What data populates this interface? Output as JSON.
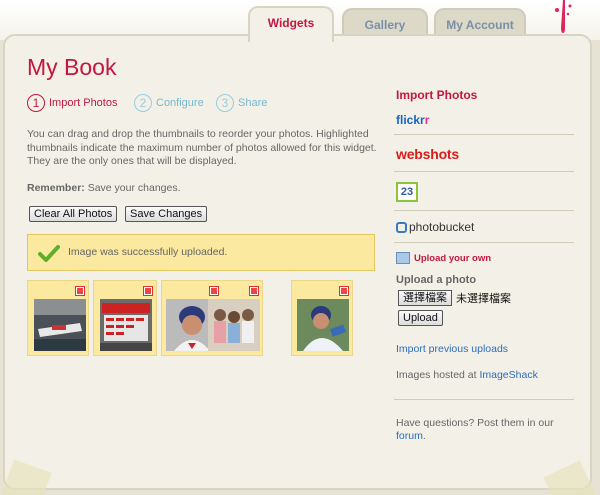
{
  "tabs": [
    {
      "label": "Widgets",
      "active": true
    },
    {
      "label": "Gallery",
      "active": false
    },
    {
      "label": "My Account",
      "active": false
    }
  ],
  "page": {
    "title": "My Book"
  },
  "steps": [
    {
      "num": "1",
      "label": "Import Photos",
      "active": true
    },
    {
      "num": "2",
      "label": "Configure",
      "active": false
    },
    {
      "num": "3",
      "label": "Share",
      "active": false
    }
  ],
  "description": "You can drag and drop the thumbnails to reorder your photos. Highlighted thumbnails indicate the maximum number of photos allowed for this widget. They are the only ones that will be displayed.",
  "remember": {
    "bold": "Remember:",
    "text": " Save your changes."
  },
  "buttons": {
    "clear_all": "Clear All Photos",
    "save_changes": "Save Changes"
  },
  "notice": {
    "message": "Image was successfully uploaded."
  },
  "sidebar": {
    "title": "Import Photos",
    "services": {
      "flickr_main": "flickr",
      "flickr_r": "r",
      "webshots": "webshots",
      "twentythree": "23",
      "photobucket": "photobucket"
    },
    "upload_own": "Upload your own",
    "upload_heading": "Upload a photo",
    "file_button": "選擇檔案",
    "file_status": "未選擇檔案",
    "upload_button": "Upload",
    "import_previous": "Import previous uploads",
    "hosted_prefix": "Images hosted at ",
    "hosted_link": "ImageShack",
    "questions_prefix": "Have questions? Post them in our",
    "questions_link": "forum",
    "questions_suffix": "."
  },
  "colors": {
    "accent": "#c4163f",
    "link": "#2a6cc0",
    "notice_bg": "#fbe9a0",
    "panel_bg": "#f3f1e7"
  }
}
